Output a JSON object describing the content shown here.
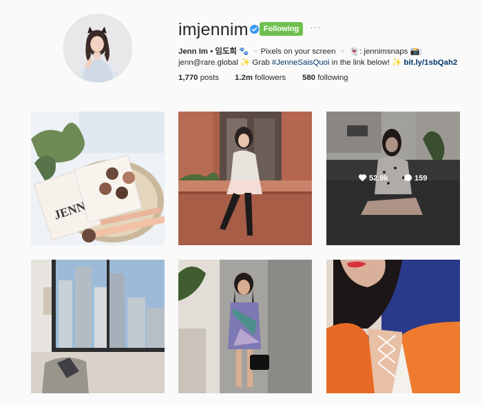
{
  "profile": {
    "username": "imjennim",
    "follow_label": "Following",
    "more_label": "···",
    "bio": {
      "name": "Jenn Im • 임도희",
      "line1_rest": " 🐾 ▫️Pixels on your screen ▫️ 👻: jennimsnaps 📸:",
      "line2_start": "jenn@rare.global ✨ Grab ",
      "hashtag": "#JenneSaisQuoi",
      "line2_mid": " in the link below! ✨ ",
      "link": "bit.ly/1sbQah2"
    }
  },
  "stats": {
    "posts_count": "1,770",
    "posts_label": "posts",
    "followers_count": "1.2m",
    "followers_label": "followers",
    "following_count": "580",
    "following_label": "following"
  },
  "posts": [
    {
      "name": "post-1-colourpop-palette"
    },
    {
      "name": "post-2-sitting-on-ledge"
    },
    {
      "name": "post-3-couch",
      "likes": "52.9k",
      "comments": "159"
    },
    {
      "name": "post-4-city-window"
    },
    {
      "name": "post-5-braids-outfit"
    },
    {
      "name": "post-6-orange-jacket"
    }
  ],
  "colors": {
    "follow_button": "#70c050",
    "link": "#003569",
    "verified": "#3897f0"
  }
}
